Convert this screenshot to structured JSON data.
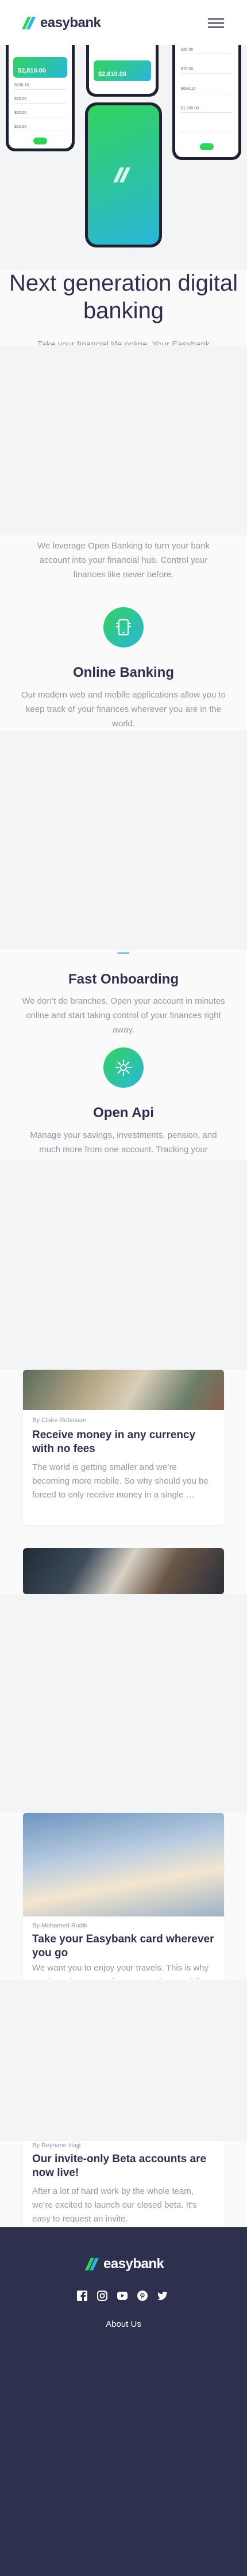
{
  "header": {
    "brand": "easybank",
    "menu_icon": "hamburger-icon"
  },
  "hero": {
    "balance_1": "$2,810.00",
    "balance_2": "$2,810.00",
    "rows_left": [
      "$698.16",
      "$35.00",
      "$60.00",
      "$50.00"
    ],
    "rows_right": [
      "$35.00",
      "$70.50",
      "$698.16",
      "$1,200.00"
    ],
    "title": "Next generation digital banking",
    "subtitle": "Take your financial life online. Your Easybank"
  },
  "features": {
    "intro": "We leverage Open Banking to turn your bank account into your financial hub. Control your finances like never before.",
    "items": [
      {
        "icon": "online-banking-icon",
        "title": "Online Banking",
        "text": "Our modern web and mobile applications allow you to keep track of your finances wherever you are in the world."
      },
      {
        "icon": "onboarding-icon",
        "title": "Fast Onboarding",
        "text": "We don’t do branches. Open your account in minutes online and start taking control of your finances right away."
      },
      {
        "icon": "open-api-icon",
        "title": "Open Api",
        "text": "Manage your savings, investments, pension, and much more from one account. Tracking your"
      }
    ]
  },
  "articles": [
    {
      "author": "By Claire Robinson",
      "title": "Receive money in any currency with no fees",
      "text": "The world is getting smaller and we’re becoming more mobile. So why should you be forced to only receive money in a single …"
    },
    {
      "author": "",
      "title": "",
      "text": ""
    },
    {
      "author": "By Mohamed Rudik",
      "title": "Take your Easybank card wherever you go",
      "text": "We want you to enjoy your travels. This is why we don’t charge any fees on purchases while you’re abroad."
    },
    {
      "author": "By Reyhane Hajji",
      "title": "Our invite-only Beta accounts are now live!",
      "text": "After a lot of hard work by the whole team, we’re excited to launch our closed beta. It’s easy to request an invite."
    }
  ],
  "footer": {
    "brand": "easybank",
    "social": [
      "facebook-icon",
      "instagram-icon",
      "youtube-icon",
      "pinterest-icon",
      "twitter-icon"
    ],
    "link": "About Us"
  },
  "colors": {
    "primary": "#2d314d",
    "green": "#31d35c",
    "cyan": "#2bb7da",
    "gray_text": "#9597a7",
    "light_bg": "#f3f4f6"
  }
}
